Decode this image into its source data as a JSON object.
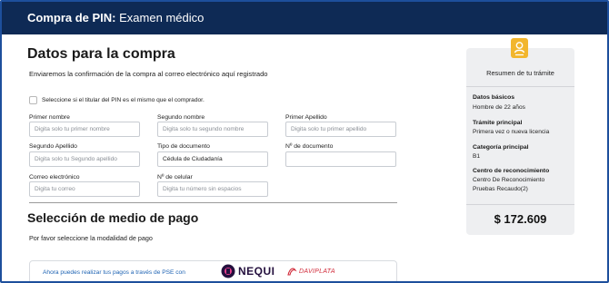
{
  "header": {
    "title_bold": "Compra de PIN:",
    "title_rest": "Examen médico"
  },
  "form": {
    "title": "Datos para la compra",
    "description": "Enviaremos la confirmación de la compra al correo electrónico aquí registrado",
    "same_buyer_label": "Seleccione si el titular del PIN es el mismo que el comprador.",
    "same_buyer_checked": false,
    "fields": [
      {
        "label": "Primer nombre",
        "placeholder": "Digita solo tu primer nombre",
        "value": ""
      },
      {
        "label": "Segundo nombre",
        "placeholder": "Digita solo tu segundo nombre",
        "value": ""
      },
      {
        "label": "Primer Apellido",
        "placeholder": "Digita solo tu primer apellido",
        "value": ""
      },
      {
        "label": "Segundo Apellido",
        "placeholder": "Digita solo tu Segundo apellido",
        "value": ""
      },
      {
        "label": "Tipo de documento",
        "placeholder": "",
        "value": "Cédula de Ciudadanía"
      },
      {
        "label": "Nº de documento",
        "placeholder": "",
        "value": ""
      },
      {
        "label": "Correo electrónico",
        "placeholder": "Digita tu correo",
        "value": ""
      },
      {
        "label": "Nº de celular",
        "placeholder": "Digita tu número sin espacios",
        "value": ""
      }
    ]
  },
  "payment": {
    "title": "Selección de medio de pago",
    "description": "Por favor seleccione la modalidad de pago",
    "pse_text": "Ahora puedes realizar tus pagos a través de PSE con",
    "nequi_label": "NEQUI",
    "daviplata_label": "DAVIPLATA"
  },
  "summary": {
    "title": "Resumen de tu trámite",
    "sections": [
      {
        "heading": "Datos básicos",
        "lines": [
          "Hombre de 22 años"
        ]
      },
      {
        "heading": "Trámite principal",
        "lines": [
          "Primera vez o nueva licencia"
        ]
      },
      {
        "heading": "Categoría principal",
        "lines": [
          "B1"
        ]
      },
      {
        "heading": "Centro de reconocimiento",
        "lines": [
          "Centro De Reconocimiento",
          "Pruebas Recaudo(2)"
        ]
      }
    ],
    "total": "$ 172.609"
  },
  "colors": {
    "header_bg": "#0e2a55",
    "frame_border": "#1d4f9c",
    "badge": "#f2b62d",
    "pse_link": "#1e63b3",
    "nequi": "#24103e",
    "daviplata": "#d12b3a"
  }
}
